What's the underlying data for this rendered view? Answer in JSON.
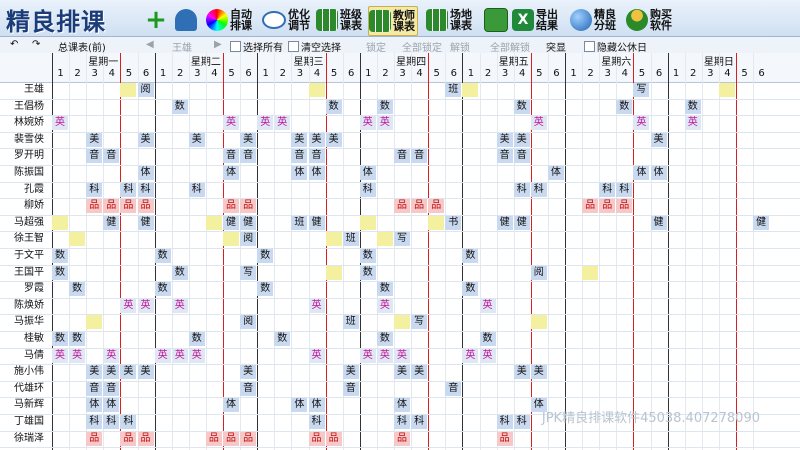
{
  "app": {
    "title": "精良排课"
  },
  "toolbar": {
    "auto": "自动排课",
    "opt": "优化调节",
    "class": "班级课表",
    "teacher": "教师课表",
    "room": "场地课表",
    "export": "导出结果",
    "split": "精良分班",
    "buy": "购买软件"
  },
  "bar2": {
    "view": "总课表(前)",
    "name": "王雄",
    "select_all": "选择所有",
    "clear": "清空选择",
    "lock": "锁定",
    "lock_all": "全部锁定",
    "unlock": "解锁",
    "unlock_all": "全部解锁",
    "highlight": "突显",
    "hide_rest": "隐藏公休日"
  },
  "days": [
    "星期一",
    "星期二",
    "星期三",
    "星期四",
    "星期五",
    "星期六",
    "星期日"
  ],
  "periods": [
    "1",
    "2",
    "3",
    "4",
    "5",
    "6"
  ],
  "teachers": [
    "王雄",
    "王倡杨",
    "林婉娇",
    "裴雪侠",
    "罗开明",
    "陈振国",
    "孔霞",
    "柳娇",
    "马超强",
    "徐王智",
    "于文平",
    "王国平",
    "罗霞",
    "陈焕娇",
    "马振华",
    "桂敏",
    "马倩",
    "施小伟",
    "代雄环",
    "马新辉",
    "丁雄国",
    "徐瑞泽"
  ],
  "schedule": [
    [
      [
        [
          "5",
          "y",
          ""
        ],
        [
          "6",
          "b",
          "阅"
        ]
      ],
      [
        []
      ],
      [
        [
          "4",
          "y",
          ""
        ]
      ],
      [
        [
          "6",
          "b",
          "班"
        ]
      ],
      [
        [
          "1",
          "y",
          ""
        ]
      ],
      [
        [
          "5",
          "b",
          "写"
        ]
      ],
      [
        [
          "4",
          "y",
          ""
        ]
      ]
    ],
    [
      [],
      [
        [
          "2",
          "b",
          "数"
        ]
      ],
      [
        [
          "5",
          "b",
          "数"
        ]
      ],
      [
        [
          "2",
          "b",
          "数"
        ]
      ],
      [
        [
          "4",
          "b",
          "数"
        ]
      ],
      [
        [
          "4",
          "b",
          "数"
        ]
      ],
      [
        [
          "2",
          "b",
          "数"
        ]
      ]
    ],
    [
      [
        [
          "1",
          "p",
          "英"
        ]
      ],
      [
        [
          "5",
          "p",
          "英"
        ]
      ],
      [
        [
          "1",
          "p",
          "英"
        ],
        [
          "2",
          "p",
          "英"
        ]
      ],
      [
        [
          "1",
          "p",
          "英"
        ],
        [
          "2",
          "p",
          "英"
        ]
      ],
      [
        [
          "5",
          "p",
          "英"
        ]
      ],
      [
        [
          "5",
          "p",
          "英"
        ]
      ],
      [
        [
          "2",
          "p",
          "英"
        ]
      ]
    ],
    [
      [
        [
          "3",
          "b",
          "美"
        ],
        [
          "6",
          "b",
          "美"
        ]
      ],
      [
        [
          "3",
          "b",
          "美"
        ],
        [
          "6",
          "b",
          "美"
        ]
      ],
      [
        [
          "3",
          "b",
          "美"
        ],
        [
          "4",
          "b",
          "美"
        ],
        [
          "5",
          "b",
          "美"
        ]
      ],
      [],
      [
        [
          "3",
          "b",
          "美"
        ],
        [
          "4",
          "b",
          "美"
        ]
      ],
      [
        [
          "6",
          "b",
          "美"
        ]
      ],
      []
    ],
    [
      [
        [
          "3",
          "b",
          "音"
        ],
        [
          "4",
          "b",
          "音"
        ]
      ],
      [
        [
          "5",
          "b",
          "音"
        ],
        [
          "6",
          "b",
          "音"
        ]
      ],
      [
        [
          "3",
          "b",
          "音"
        ],
        [
          "4",
          "b",
          "音"
        ]
      ],
      [
        [
          "3",
          "b",
          "音"
        ],
        [
          "4",
          "b",
          "音"
        ]
      ],
      [
        [
          "3",
          "b",
          "音"
        ],
        [
          "4",
          "b",
          "音"
        ]
      ],
      [],
      []
    ],
    [
      [
        [
          "6",
          "b",
          "体"
        ]
      ],
      [
        [
          "5",
          "b",
          "体"
        ]
      ],
      [
        [
          "3",
          "b",
          "体"
        ],
        [
          "4",
          "b",
          "体"
        ]
      ],
      [
        [
          "1",
          "b",
          "体"
        ]
      ],
      [
        [
          "6",
          "b",
          "体"
        ]
      ],
      [
        [
          "5",
          "b",
          "体"
        ],
        [
          "6",
          "b",
          "体"
        ]
      ],
      []
    ],
    [
      [
        [
          "3",
          "b",
          "科"
        ],
        [
          "5",
          "b",
          "科"
        ],
        [
          "6",
          "b",
          "科"
        ]
      ],
      [
        [
          "3",
          "b",
          "科"
        ]
      ],
      [],
      [
        [
          "1",
          "b",
          "科"
        ]
      ],
      [
        [
          "4",
          "b",
          "科"
        ],
        [
          "5",
          "b",
          "科"
        ]
      ],
      [
        [
          "3",
          "b",
          "科"
        ],
        [
          "4",
          "b",
          "科"
        ]
      ],
      []
    ],
    [
      [
        [
          "3",
          "r",
          "品"
        ],
        [
          "4",
          "r",
          "品"
        ],
        [
          "5",
          "r",
          "品"
        ],
        [
          "6",
          "r",
          "品"
        ]
      ],
      [
        [
          "5",
          "r",
          "品"
        ],
        [
          "6",
          "r",
          "品"
        ]
      ],
      [],
      [
        [
          "3",
          "r",
          "品"
        ],
        [
          "4",
          "r",
          "品"
        ],
        [
          "5",
          "r",
          "品"
        ]
      ],
      [],
      [
        [
          "2",
          "r",
          "品"
        ],
        [
          "3",
          "r",
          "品"
        ],
        [
          "4",
          "r",
          "品"
        ]
      ],
      []
    ],
    [
      [
        [
          "1",
          "y",
          ""
        ],
        [
          "4",
          "b",
          "健"
        ],
        [
          "6",
          "b",
          "健"
        ]
      ],
      [
        [
          "4",
          "y",
          ""
        ],
        [
          "5",
          "b",
          "健"
        ],
        [
          "6",
          "b",
          "健"
        ]
      ],
      [
        [
          "3",
          "b",
          "班"
        ],
        [
          "4",
          "b",
          "健"
        ]
      ],
      [
        [
          "5",
          "y",
          ""
        ],
        [
          "6",
          "b",
          "书"
        ],
        [
          "1",
          "y",
          ""
        ]
      ],
      [
        [
          "3",
          "b",
          "健"
        ],
        [
          "4",
          "b",
          "健"
        ]
      ],
      [
        [
          "6",
          "b",
          "健"
        ]
      ],
      [
        [
          "6",
          "b",
          "健"
        ]
      ]
    ],
    [
      [
        [
          "2",
          "y",
          ""
        ]
      ],
      [
        [
          "5",
          "y",
          ""
        ],
        [
          "6",
          "b",
          "阅"
        ]
      ],
      [
        [
          "5",
          "y",
          ""
        ],
        [
          "6",
          "b",
          "班"
        ]
      ],
      [
        [
          "2",
          "y",
          ""
        ],
        [
          "3",
          "b",
          "写"
        ]
      ],
      [],
      [],
      []
    ],
    [
      [
        [
          "1",
          "b",
          "数"
        ]
      ],
      [
        [
          "1",
          "b",
          "数"
        ]
      ],
      [
        [
          "1",
          "b",
          "数"
        ]
      ],
      [
        [
          "1",
          "b",
          "数"
        ]
      ],
      [
        [
          "1",
          "b",
          "数"
        ]
      ],
      [],
      []
    ],
    [
      [
        [
          "1",
          "b",
          "数"
        ]
      ],
      [
        [
          "2",
          "b",
          "数"
        ],
        [
          "6",
          "b",
          "写"
        ]
      ],
      [
        [
          "5",
          "y",
          ""
        ]
      ],
      [
        [
          "1",
          "b",
          "数"
        ]
      ],
      [
        [
          "5",
          "b",
          "阅"
        ]
      ],
      [
        [
          "2",
          "y",
          ""
        ]
      ],
      []
    ],
    [
      [
        [
          "2",
          "b",
          "数"
        ]
      ],
      [
        [
          "1",
          "b",
          "数"
        ]
      ],
      [
        [
          "1",
          "b",
          "数"
        ]
      ],
      [
        [
          "2",
          "b",
          "数"
        ]
      ],
      [
        [
          "1",
          "b",
          "数"
        ]
      ],
      [],
      []
    ],
    [
      [
        [
          "5",
          "p",
          "英"
        ],
        [
          "6",
          "p",
          "英"
        ]
      ],
      [
        [
          "2",
          "p",
          "英"
        ]
      ],
      [
        [
          "4",
          "p",
          "英"
        ]
      ],
      [
        [
          "2",
          "p",
          "英"
        ]
      ],
      [
        [
          "2",
          "p",
          "英"
        ]
      ],
      [],
      []
    ],
    [
      [
        [
          "3",
          "y",
          ""
        ]
      ],
      [
        [
          "6",
          "b",
          "阅"
        ]
      ],
      [
        [
          "6",
          "b",
          "班"
        ]
      ],
      [
        [
          "3",
          "y",
          ""
        ],
        [
          "4",
          "b",
          "写"
        ]
      ],
      [
        [
          "5",
          "y",
          ""
        ]
      ],
      [],
      []
    ],
    [
      [
        [
          "1",
          "b",
          "数"
        ],
        [
          "2",
          "b",
          "数"
        ]
      ],
      [
        [
          "3",
          "b",
          "数"
        ]
      ],
      [
        [
          "2",
          "b",
          "数"
        ]
      ],
      [
        [
          "2",
          "b",
          "数"
        ]
      ],
      [
        [
          "2",
          "b",
          "数"
        ]
      ],
      [],
      []
    ],
    [
      [
        [
          "1",
          "p",
          "英"
        ],
        [
          "2",
          "p",
          "英"
        ],
        [
          "4",
          "p",
          "英"
        ]
      ],
      [
        [
          "1",
          "p",
          "英"
        ],
        [
          "2",
          "p",
          "英"
        ],
        [
          "3",
          "p",
          "英"
        ]
      ],
      [
        [
          "4",
          "p",
          "英"
        ]
      ],
      [
        [
          "1",
          "p",
          "英"
        ],
        [
          "2",
          "p",
          "英"
        ],
        [
          "3",
          "p",
          "英"
        ]
      ],
      [
        [
          "1",
          "p",
          "英"
        ],
        [
          "2",
          "p",
          "英"
        ]
      ],
      [],
      []
    ],
    [
      [
        [
          "3",
          "b",
          "美"
        ],
        [
          "4",
          "b",
          "美"
        ],
        [
          "5",
          "b",
          "美"
        ],
        [
          "6",
          "b",
          "美"
        ]
      ],
      [
        [
          "6",
          "b",
          "美"
        ]
      ],
      [
        [
          "6",
          "b",
          "美"
        ]
      ],
      [
        [
          "4",
          "b",
          "美"
        ],
        [
          "3",
          "b",
          "美"
        ]
      ],
      [
        [
          "4",
          "b",
          "美"
        ],
        [
          "5",
          "b",
          "美"
        ]
      ],
      [],
      []
    ],
    [
      [
        [
          "3",
          "b",
          "音"
        ],
        [
          "4",
          "b",
          "音"
        ]
      ],
      [
        [
          "6",
          "b",
          "音"
        ]
      ],
      [
        [
          "6",
          "b",
          "音"
        ]
      ],
      [
        [
          "6",
          "b",
          "音"
        ]
      ],
      [],
      [],
      []
    ],
    [
      [
        [
          "3",
          "b",
          "体"
        ],
        [
          "4",
          "b",
          "体"
        ]
      ],
      [
        [
          "5",
          "b",
          "体"
        ]
      ],
      [
        [
          "3",
          "b",
          "体"
        ],
        [
          "4",
          "b",
          "体"
        ]
      ],
      [
        [
          "3",
          "b",
          "体"
        ]
      ],
      [
        [
          "5",
          "b",
          "体"
        ]
      ],
      [],
      []
    ],
    [
      [
        [
          "3",
          "b",
          "科"
        ],
        [
          "4",
          "b",
          "科"
        ],
        [
          "5",
          "b",
          "科"
        ]
      ],
      [],
      [
        [
          "4",
          "b",
          "科"
        ]
      ],
      [
        [
          "3",
          "b",
          "科"
        ],
        [
          "4",
          "b",
          "科"
        ]
      ],
      [
        [
          "3",
          "b",
          "科"
        ],
        [
          "4",
          "b",
          "科"
        ]
      ],
      [],
      []
    ],
    [
      [
        [
          "3",
          "r",
          "品"
        ],
        [
          "5",
          "r",
          "品"
        ],
        [
          "6",
          "r",
          "品"
        ]
      ],
      [
        [
          "4",
          "r",
          "品"
        ],
        [
          "5",
          "r",
          "品"
        ],
        [
          "6",
          "r",
          "品"
        ]
      ],
      [
        [
          "4",
          "r",
          "品"
        ],
        [
          "5",
          "r",
          "品"
        ]
      ],
      [
        [
          "3",
          "r",
          "品"
        ]
      ],
      [
        [
          "3",
          "r",
          "品"
        ]
      ],
      [],
      []
    ]
  ],
  "watermark": "JPK精良排课软件45038.407278090"
}
